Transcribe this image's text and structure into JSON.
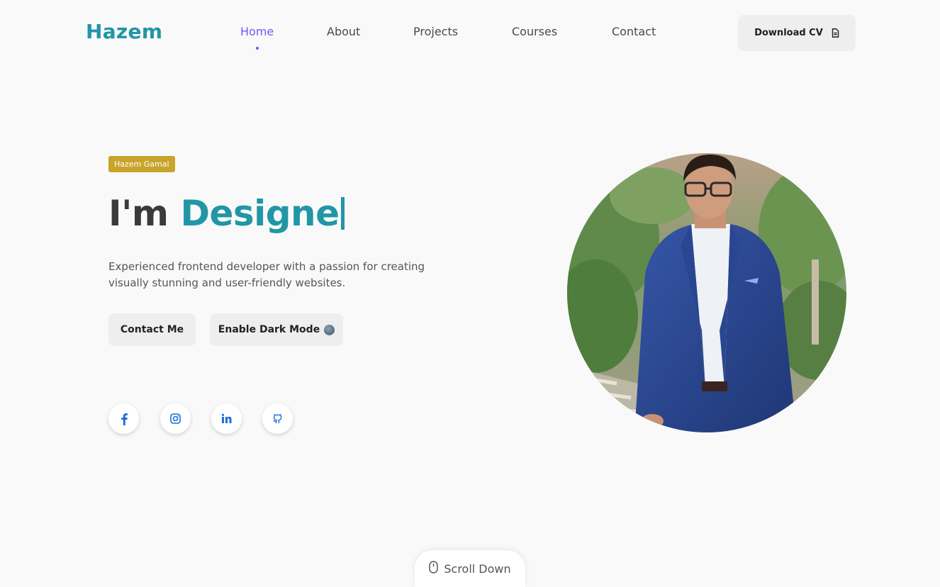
{
  "header": {
    "logo": "Hazem",
    "nav": [
      {
        "label": "Home",
        "active": true
      },
      {
        "label": "About",
        "active": false
      },
      {
        "label": "Projects",
        "active": false
      },
      {
        "label": "Courses",
        "active": false
      },
      {
        "label": "Contact",
        "active": false
      }
    ],
    "cv_button": {
      "label": "Download CV",
      "icon": "document-icon"
    }
  },
  "hero": {
    "badge": "Hazem Gamal",
    "headline_prefix": "I'm",
    "headline_role": "Designe",
    "description": "Experienced frontend developer with a passion for creating visually stunning and user-friendly websites.",
    "buttons": {
      "contact": "Contact Me",
      "dark_mode": "Enable Dark Mode"
    },
    "socials": [
      {
        "name": "facebook-icon"
      },
      {
        "name": "instagram-icon"
      },
      {
        "name": "linkedin-icon"
      },
      {
        "name": "github-icon"
      }
    ]
  },
  "scroll": {
    "label": "Scroll Down",
    "icon": "mouse-icon"
  },
  "colors": {
    "accent": "#2196a6",
    "nav_active": "#6a5af9",
    "badge": "#c8a42a",
    "social_icon": "#1a6fd6"
  }
}
